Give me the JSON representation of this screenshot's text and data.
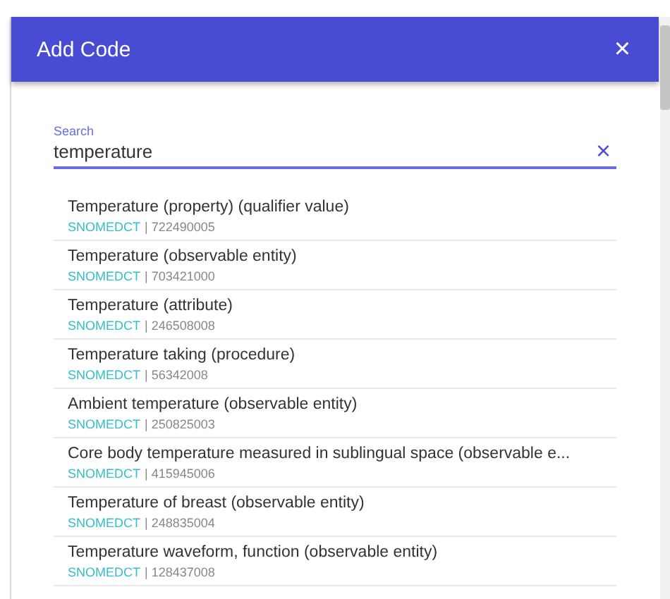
{
  "dialog": {
    "title": "Add Code",
    "close": "×"
  },
  "search": {
    "label": "Search",
    "value": "temperature",
    "clear": "×"
  },
  "results": [
    {
      "name": "Temperature (property) (qualifier value)",
      "system": "SNOMEDCT",
      "code": "| 722490005"
    },
    {
      "name": "Temperature (observable entity)",
      "system": "SNOMEDCT",
      "code": "| 703421000"
    },
    {
      "name": "Temperature (attribute)",
      "system": "SNOMEDCT",
      "code": "| 246508008"
    },
    {
      "name": "Temperature taking (procedure)",
      "system": "SNOMEDCT",
      "code": "| 56342008"
    },
    {
      "name": "Ambient temperature (observable entity)",
      "system": "SNOMEDCT",
      "code": "| 250825003"
    },
    {
      "name": "Core body temperature measured in sublingual space (observable e...",
      "system": "SNOMEDCT",
      "code": "| 415945006"
    },
    {
      "name": "Temperature of breast (observable entity)",
      "system": "SNOMEDCT",
      "code": "| 248835004"
    },
    {
      "name": "Temperature waveform, function (observable entity)",
      "system": "SNOMEDCT",
      "code": "| 128437008"
    }
  ]
}
